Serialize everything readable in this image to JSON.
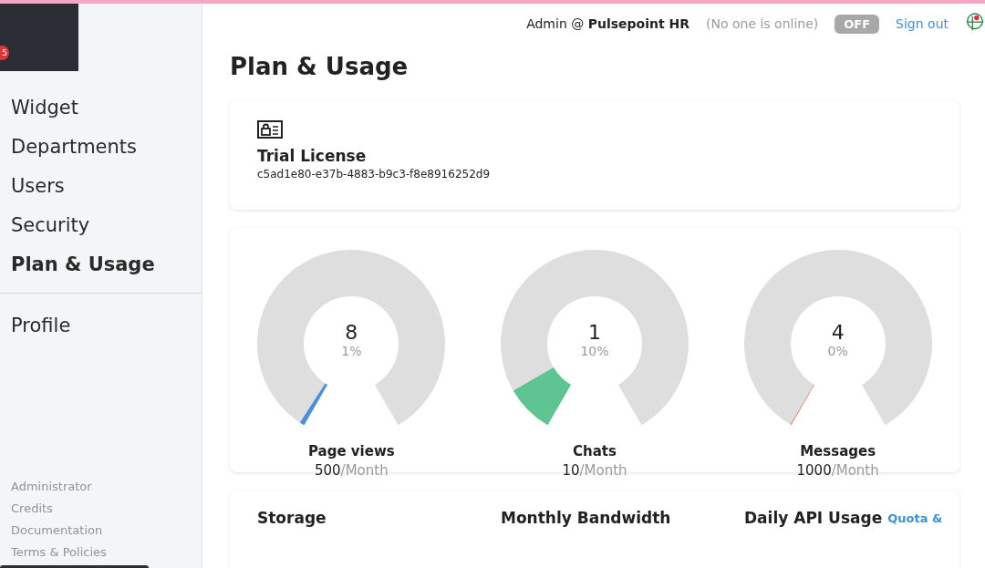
{
  "header": {
    "user": "Admin @ ",
    "org": "Pulsepoint HR",
    "online_status": "(No one is online)",
    "toggle": {
      "label": "OFF",
      "on": false
    },
    "sign_out": "Sign out"
  },
  "popup": {
    "badge": "5"
  },
  "sidebar": {
    "items": [
      {
        "label": "Widget",
        "selected": false
      },
      {
        "label": "Departments",
        "selected": false
      },
      {
        "label": "Users",
        "selected": false
      },
      {
        "label": "Security",
        "selected": false
      },
      {
        "label": "Plan & Usage",
        "selected": true
      }
    ],
    "profile": {
      "label": "Profile",
      "selected": false
    },
    "footer_links": [
      "Administrator",
      "Credits",
      "Documentation",
      "Terms & Policies"
    ]
  },
  "page_title": "Plan & Usage",
  "license": {
    "title": "Trial License",
    "key": "c5ad1e80-e37b-4883-b9c3-f8e8916252d9"
  },
  "gauges": [
    {
      "value": "8",
      "percent": "1%",
      "color": "#4a90d9",
      "label": "Page views",
      "limit": "500",
      "unit": "/Month"
    },
    {
      "value": "1",
      "percent": "10%",
      "color": "#5ec592",
      "label": "Chats",
      "limit": "10",
      "unit": "/Month"
    },
    {
      "value": "4",
      "percent": "0%",
      "color": "#e8826a",
      "label": "Messages",
      "limit": "1000",
      "unit": "/Month"
    }
  ],
  "bottom": {
    "columns": [
      "Storage",
      "Monthly Bandwidth",
      "Daily API Usage"
    ],
    "link": "Quota &"
  }
}
